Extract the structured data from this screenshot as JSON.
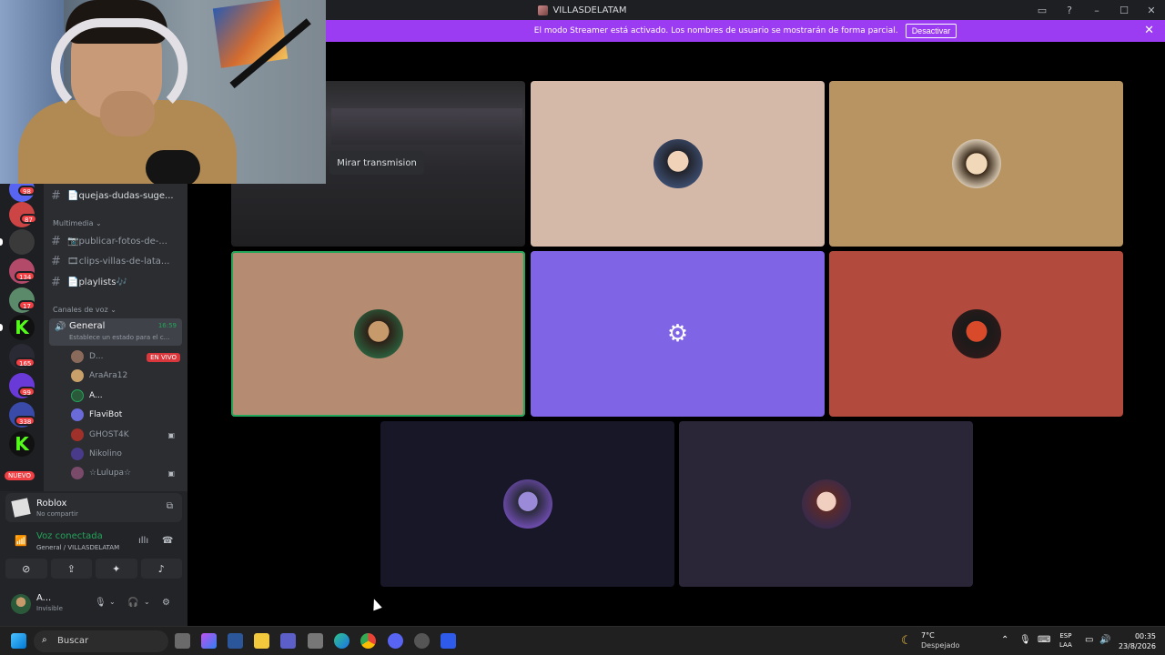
{
  "window": {
    "title": "VILLASDELATAM"
  },
  "banner": {
    "message": "El modo Streamer está activado. Los nombres de usuario se mostrarán de forma parcial.",
    "button": "Desactivar",
    "close": "✕"
  },
  "rail": {
    "badges": [
      "98",
      "87",
      "134",
      "17",
      "165",
      "99",
      "338"
    ],
    "new_label": "NUEVO"
  },
  "sidebar": {
    "text_channels_top": [
      {
        "name": "📄quejas-dudas-suge..."
      }
    ],
    "category_media": "Multimedia",
    "media_channels": [
      {
        "name": "📷publicar-fotos-de-..."
      },
      {
        "name": "🎞clips-villas-de-lata..."
      },
      {
        "name": "📄playlists🎶"
      }
    ],
    "category_voice": "Canales de voz",
    "voice_channel": {
      "name": "General",
      "time": "16:59",
      "status": "Establece un estado para el c..."
    },
    "voice_users": [
      {
        "name": "D...",
        "live": "EN VIVO",
        "color": "#8a6a5a"
      },
      {
        "name": "AraAra12",
        "color": "#c9a06a"
      },
      {
        "name": "A...",
        "color": "#2b5a3a"
      },
      {
        "name": "FlaviBot",
        "color": "#6a6ad8"
      },
      {
        "name": "GHOST4K",
        "color": "#a0302a"
      },
      {
        "name": "Nikolino",
        "color": "#4a3a8a"
      },
      {
        "name": "☆Lulupa☆",
        "color": "#7a4a6a"
      }
    ]
  },
  "panel": {
    "game": "Roblox",
    "game_sub": "No compartir",
    "voice_title": "Voz conectada",
    "voice_sub": "General / VILLASDELATAM",
    "user_name": "A...",
    "user_status": "Invisible"
  },
  "stage": {
    "watch_button": "Mirar transmision"
  },
  "taskbar": {
    "search": "Buscar",
    "weather_temp": "7°C",
    "weather_desc": "Despejado",
    "lang1": "ESP",
    "lang2": "LAA",
    "time": "00:35",
    "date": "23/8/2026"
  }
}
